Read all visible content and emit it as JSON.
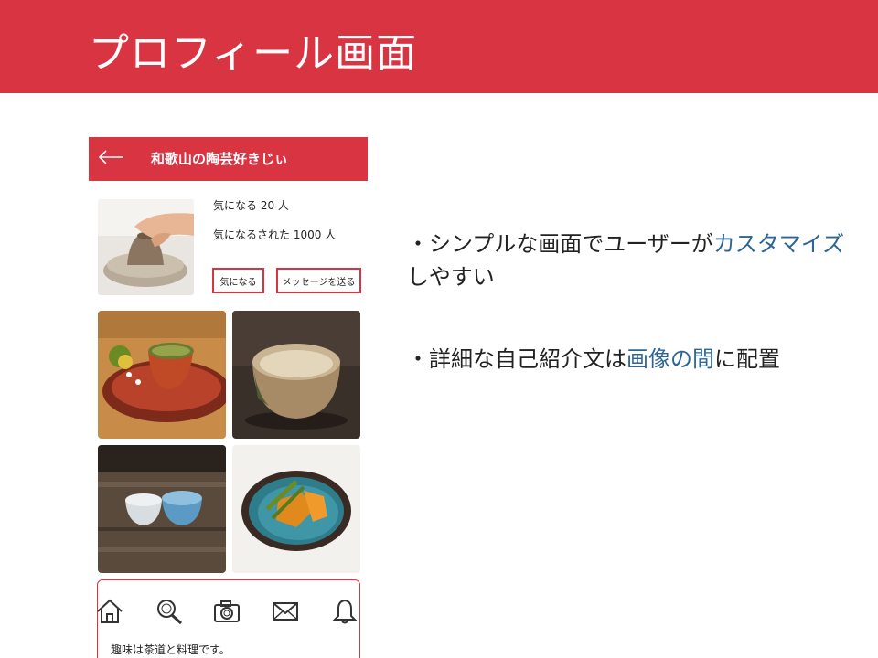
{
  "slide": {
    "title": "プロフィール画面"
  },
  "phone": {
    "title": "和歌山の陶芸好きじぃ",
    "stats": {
      "interested": "気になる 20 人",
      "interested_by": "気になるされた 1000 人"
    },
    "buttons": {
      "follow": "気になる",
      "message": "メッセージを送る"
    },
    "nav_icons": [
      "home-icon",
      "search-icon",
      "camera-icon",
      "mail-icon",
      "bell-icon"
    ],
    "bio": "趣味は茶道と料理です。"
  },
  "bullets": [
    {
      "prefix": "・シンプルな画面でユーザーが",
      "highlight": "カスタマイズ",
      "suffix": "しやすい"
    },
    {
      "prefix": "・詳細な自己紹介文は",
      "highlight": "画像の間",
      "suffix": "に配置"
    }
  ],
  "colors": {
    "brand_red": "#d93442",
    "accent_blue": "#2e6597"
  }
}
